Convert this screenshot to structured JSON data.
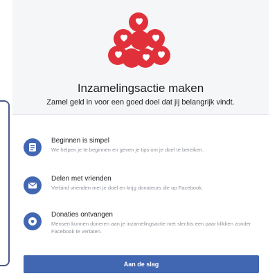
{
  "header": {
    "title": "Inzamelingsactie maken",
    "subtitle": "Zamel geld in voor een goed doel dat jij belangrijk vindt."
  },
  "items": [
    {
      "icon": "guide-icon",
      "title": "Beginnen is simpel",
      "description": "We helpen je te beginnen en geven je tips om je doel te bereiken."
    },
    {
      "icon": "message-icon",
      "title": "Delen met vrienden",
      "description": "Verbind vrienden met je doel en krijg donateurs die op Facebook."
    },
    {
      "icon": "donate-icon",
      "title": "Donaties ontvangen",
      "description": "Mensen kunnen doneren aan je inzamelingsactie met slechts een paar klikken zonder Facebook te verlaten."
    }
  ],
  "cta": {
    "label": "Aan de slag"
  },
  "colors": {
    "accent": "#4267b2",
    "heart_red": "#e0313b",
    "hero_bg": "#f5f6f7"
  }
}
